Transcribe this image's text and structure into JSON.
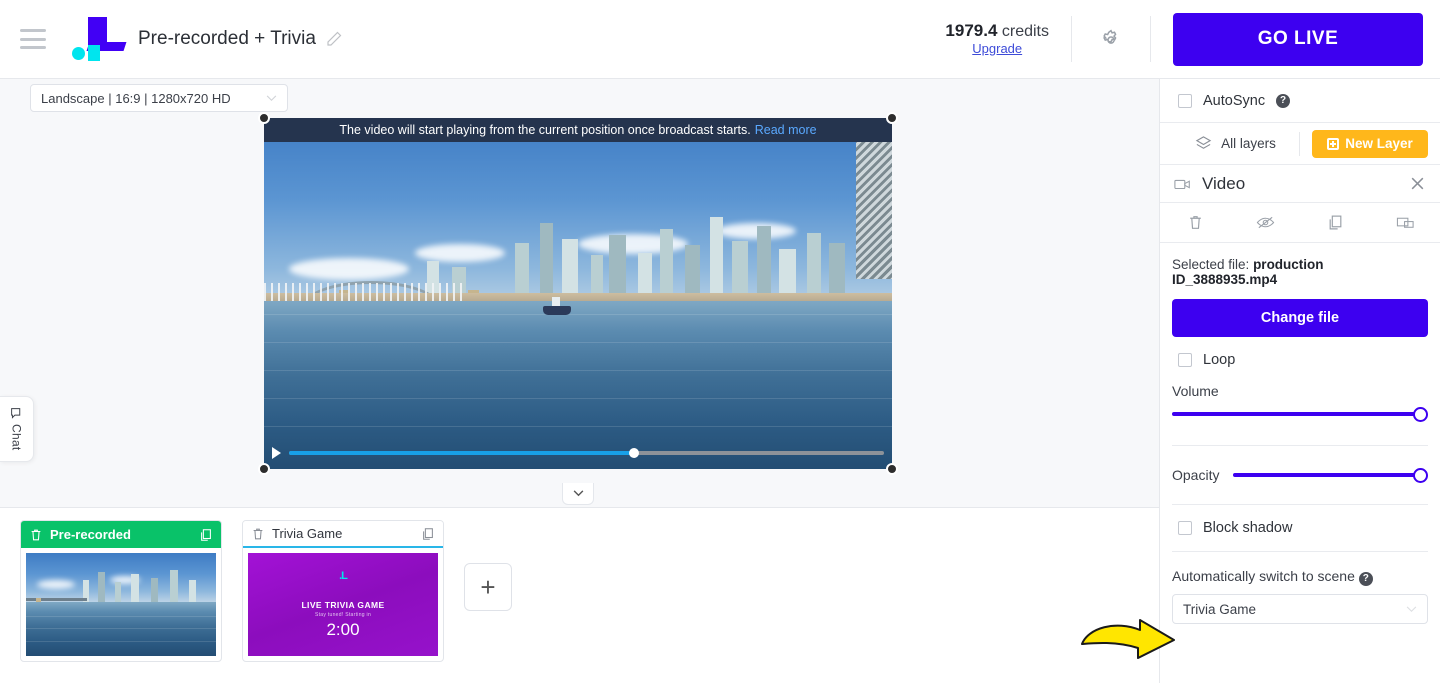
{
  "header": {
    "menu_icon": "hamburger-icon",
    "logo_alt": "brand-logo",
    "project_title": "Pre-recorded + Trivia",
    "edit_icon": "pencil-icon",
    "credits_value": "1979.4",
    "credits_label": "credits",
    "upgrade_label": "Upgrade",
    "settings_icon": "gear-icon",
    "go_live_label": "GO LIVE"
  },
  "stage": {
    "layout_selected": "Landscape | 16:9 | 1280x720 HD",
    "banner_text": "The video will start playing from the current position once broadcast starts.",
    "banner_link": "Read more",
    "play_icon": "play-icon",
    "progress_percent": 58,
    "collapse_icon": "chevron-down-icon"
  },
  "chat": {
    "label": "Chat",
    "icon": "chat-bubble-icon"
  },
  "scenes": {
    "cards": [
      {
        "name": "Pre-recorded",
        "state": "active",
        "delete_icon": "trash-icon",
        "duplicate_icon": "copy-icon",
        "thumb_type": "photo"
      },
      {
        "name": "Trivia Game",
        "state": "inactive",
        "delete_icon": "trash-icon",
        "duplicate_icon": "copy-icon",
        "thumb_type": "trivia",
        "thumb_logo": ".L",
        "thumb_title": "LIVE TRIVIA GAME",
        "thumb_sub": "Stay tuned! Starting in",
        "thumb_timer": "2:00"
      }
    ],
    "add_label": "+"
  },
  "panel": {
    "autosync_label": "AutoSync",
    "autosync_checked": false,
    "help_icon": "question-mark-icon",
    "all_layers_label": "All layers",
    "layers_icon": "layers-icon",
    "new_layer_label": "New Layer",
    "layer_name": "Video",
    "layer_icon": "video-camera-icon",
    "close_icon": "close-icon",
    "tools": [
      {
        "name": "delete-layer",
        "icon": "trash-icon"
      },
      {
        "name": "hide-layer",
        "icon": "eye-off-icon"
      },
      {
        "name": "duplicate-layer",
        "icon": "copy-icon"
      },
      {
        "name": "move-layer-to-scene",
        "icon": "screens-icon"
      }
    ],
    "selected_file_label": "Selected file:",
    "selected_file_name": "production ID_3888935.mp4",
    "change_file_label": "Change file",
    "loop_label": "Loop",
    "loop_checked": false,
    "volume_label": "Volume",
    "volume_percent": 100,
    "opacity_label": "Opacity",
    "opacity_percent": 100,
    "block_shadow_label": "Block shadow",
    "block_shadow_checked": false,
    "auto_switch_label": "Automatically switch to scene",
    "auto_switch_value": "Trivia Game",
    "chevron_icon": "chevron-down-icon"
  },
  "colors": {
    "brand_purple": "#3d00f0",
    "accent_yellow": "#ffb71b",
    "active_green": "#09c269",
    "link_blue": "#3d4bd8",
    "progress_blue": "#18a0e8",
    "annotation_yellow": "#ffe600"
  }
}
